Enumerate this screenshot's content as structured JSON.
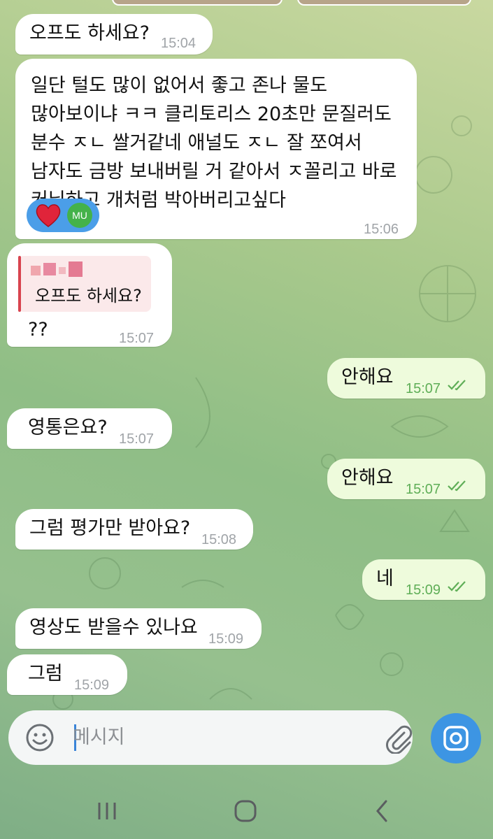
{
  "messages": [
    {
      "type": "in",
      "text": "오프도 하세요?",
      "time": "15:04"
    },
    {
      "type": "in",
      "lines": [
        "일단 털도 많이 없어서 좋고 존나 물도",
        "많아보이냐 ㅋㅋ 클리토리스 20초만 문질러도",
        "분수 ㅈㄴ 쌀거같네 애널도 ㅈㄴ 잘 쪼여서",
        "남자도 금방 보내버릴 거 같아서 ㅈ꼴리고 바로",
        "커닐하고 개처럼 박아버리고싶다"
      ],
      "time": "15:06",
      "reaction": {
        "emoji": "heart",
        "avatar": "MU"
      }
    },
    {
      "type": "in",
      "quote": "오프도 하세요?",
      "text": "??",
      "time": "15:07"
    },
    {
      "type": "out",
      "text": "안해요",
      "time": "15:07"
    },
    {
      "type": "in",
      "text": "영통은요?",
      "time": "15:07"
    },
    {
      "type": "out",
      "text": "안해요",
      "time": "15:07"
    },
    {
      "type": "in",
      "text": "그럼 평가만 받아요?",
      "time": "15:08"
    },
    {
      "type": "out",
      "text": "네",
      "time": "15:09"
    },
    {
      "type": "in",
      "text": "영상도 받을수 있나요",
      "time": "15:09"
    },
    {
      "type": "in",
      "text": "그럼",
      "time": "15:09"
    }
  ],
  "composer": {
    "placeholder": "메시지"
  },
  "icons": {
    "emoji": "smiley-icon",
    "attach": "paperclip-icon",
    "camera": "camera-icon",
    "recent": "recent-apps-icon",
    "home": "home-icon",
    "back": "back-icon"
  }
}
